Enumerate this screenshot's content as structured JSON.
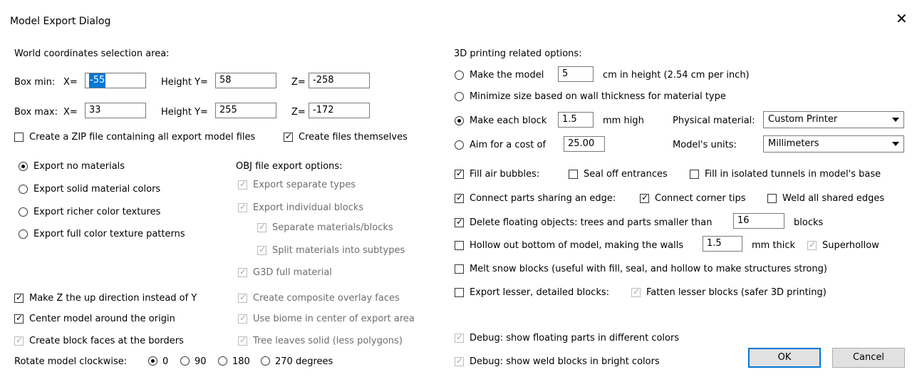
{
  "title": "Model Export Dialog",
  "close_glyph": "✕",
  "world": {
    "heading": "World coordinates selection area:",
    "box_min_label": "Box min:",
    "box_max_label": "Box max:",
    "x_label": "X=",
    "y_label": "Height Y=",
    "z_label": "Z=",
    "min_x": "-55",
    "min_y": "58",
    "min_z": "-258",
    "max_x": "33",
    "max_y": "255",
    "max_z": "-172"
  },
  "zip": {
    "label": "Create a ZIP file containing all export model files",
    "checked": false
  },
  "files": {
    "label": "Create files themselves",
    "checked": true
  },
  "materials": [
    {
      "label": "Export no materials",
      "selected": true
    },
    {
      "label": "Export solid material colors",
      "selected": false
    },
    {
      "label": "Export richer color textures",
      "selected": false
    },
    {
      "label": "Export full color texture patterns",
      "selected": false
    }
  ],
  "obj": {
    "heading": "OBJ file export options:",
    "separate_types": "Export separate types",
    "individual_blocks": "Export individual blocks",
    "separate_materials": "Separate materials/blocks",
    "split_materials": "Split materials into subtypes",
    "g3d": "G3D full material",
    "composite": "Create composite overlay faces",
    "biome": "Use biome in center of export area",
    "tree_leaves": "Tree leaves solid (less polygons)"
  },
  "left_opts": {
    "z_up": "Make Z the up direction instead of Y",
    "center": "Center model around the origin",
    "borders": "Create block faces at the borders"
  },
  "rotate": {
    "label": "Rotate model clockwise:",
    "options": [
      "0",
      "90",
      "180",
      "270 degrees"
    ],
    "selected": "0"
  },
  "printing": {
    "heading": "3D printing related options:",
    "make_model_prefix": "Make the model",
    "height_value": "5",
    "make_model_suffix": "cm in height (2.54 cm per inch)",
    "minimize": "Minimize size based on wall thickness for material type",
    "block_prefix": "Make each block",
    "block_value": "1.5",
    "block_suffix": "mm high",
    "cost_prefix": "Aim for a cost of",
    "cost_value": "25.00",
    "selected_option": "Make each block",
    "material_label": "Physical material:",
    "material_value": "Custom Printer",
    "units_label": "Model's units:",
    "units_value": "Millimeters"
  },
  "fill": {
    "fill_air": "Fill air bubbles:",
    "seal_off": "Seal off entrances",
    "fill_tunnels": "Fill in isolated tunnels in model's base",
    "connect_parts": "Connect parts sharing an edge:",
    "connect_corner": "Connect corner tips",
    "weld": "Weld all shared edges",
    "delete_prefix": "Delete floating objects: trees and parts smaller than",
    "delete_value": "16",
    "delete_suffix": "blocks",
    "hollow_prefix": "Hollow out bottom of model, making the walls",
    "hollow_value": "1.5",
    "hollow_suffix": "mm thick",
    "superhollow": "Superhollow",
    "melt_snow": "Melt snow blocks (useful with fill, seal, and hollow to make structures strong)",
    "export_lesser": "Export lesser, detailed blocks:",
    "fatten": "Fatten lesser blocks (safer 3D printing)"
  },
  "debug": {
    "floating": "Debug: show floating parts in different colors",
    "weld": "Debug: show weld blocks in bright colors"
  },
  "buttons": {
    "ok": "OK",
    "cancel": "Cancel"
  },
  "icons": {
    "check": "✓"
  }
}
